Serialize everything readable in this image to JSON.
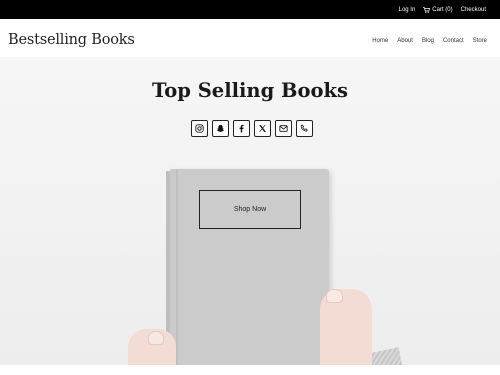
{
  "topbar": {
    "login": "Log In",
    "cart": "Cart (0)",
    "checkout": "Checkout"
  },
  "header": {
    "brand": "Bestselling Books",
    "nav": [
      "Home",
      "About",
      "Blog",
      "Contact",
      "Store"
    ]
  },
  "hero": {
    "title": "Top Selling Books",
    "button": "Shop Now"
  },
  "socials": [
    "instagram-icon",
    "snapchat-icon",
    "facebook-icon",
    "x-icon",
    "email-icon",
    "phone-icon"
  ]
}
